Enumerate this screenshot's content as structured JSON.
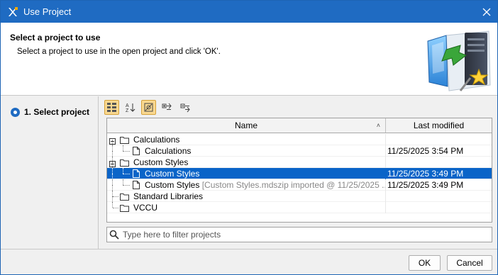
{
  "window": {
    "title": "Use Project",
    "close_icon": "close-icon"
  },
  "header": {
    "title": "Select a project to use",
    "description": "Select a project to use in the open project and click 'OK'."
  },
  "steps": [
    {
      "label": "1. Select project",
      "selected": true
    }
  ],
  "toolbar": {
    "buttons": [
      {
        "icon": "tree-view-icon",
        "active": true
      },
      {
        "icon": "sort-az-icon",
        "active": false
      },
      {
        "icon": "hide-used-icon",
        "active": true
      },
      {
        "icon": "expand-all-icon",
        "active": false
      },
      {
        "icon": "collapse-all-icon",
        "active": false
      }
    ]
  },
  "table": {
    "columns": {
      "name": "Name",
      "last_modified": "Last modified"
    },
    "rows": [
      {
        "type": "folder",
        "name": "Calculations",
        "suffix": "",
        "modified": "",
        "selected": false
      },
      {
        "type": "file",
        "name": "Calculations",
        "suffix": "",
        "modified": "11/25/2025 3:54 PM",
        "selected": false
      },
      {
        "type": "folder",
        "name": "Custom Styles",
        "suffix": "",
        "modified": "",
        "selected": false
      },
      {
        "type": "file",
        "name": "Custom Styles",
        "suffix": "",
        "modified": "11/25/2025 3:49 PM",
        "selected": true
      },
      {
        "type": "file",
        "name": "Custom Styles",
        "suffix": "[Custom Styles.mdszip imported @ 11/25/2025 ...",
        "modified": "11/25/2025 3:49 PM",
        "selected": false
      },
      {
        "type": "folder",
        "name": "Standard Libraries",
        "suffix": "",
        "modified": "",
        "selected": false
      },
      {
        "type": "folder",
        "name": "VCCU",
        "suffix": "",
        "modified": "",
        "selected": false
      }
    ]
  },
  "filter": {
    "placeholder": "Type here to filter projects",
    "value": ""
  },
  "footer": {
    "ok_label": "OK",
    "cancel_label": "Cancel"
  },
  "colors": {
    "title_bar": "#1f6bc2",
    "selection": "#0a64c8",
    "toolbar_active": "#f9d890"
  }
}
